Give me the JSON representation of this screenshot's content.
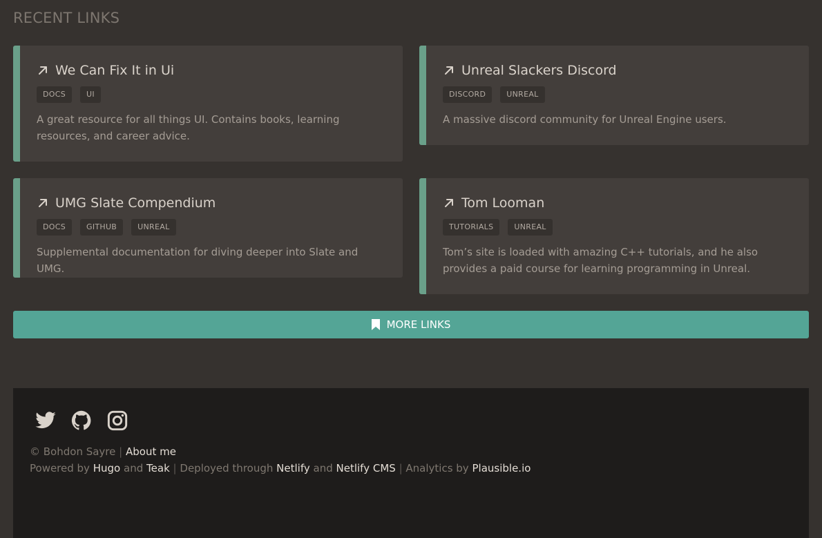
{
  "section": {
    "title": "RECENT LINKS"
  },
  "cards": [
    {
      "title": "We Can Fix It in Ui",
      "tags": [
        "DOCS",
        "UI"
      ],
      "description": "A great resource for all things UI. Contains books, learning resources, and career advice."
    },
    {
      "title": "Unreal Slackers Discord",
      "tags": [
        "DISCORD",
        "UNREAL"
      ],
      "description": "A massive discord community for Unreal Engine users."
    },
    {
      "title": "UMG Slate Compendium",
      "tags": [
        "DOCS",
        "GITHUB",
        "UNREAL"
      ],
      "description": "Supplemental documentation for diving deeper into Slate and UMG."
    },
    {
      "title": "Tom Looman",
      "tags": [
        "TUTORIALS",
        "UNREAL"
      ],
      "description": "Tom’s site is loaded with amazing C++ tutorials, and he also provides a paid course for learning programming in Unreal."
    }
  ],
  "more_button": {
    "label": "MORE LINKS",
    "icon": "bookmark-icon"
  },
  "footer": {
    "social": [
      {
        "icon": "twitter-icon"
      },
      {
        "icon": "github-icon"
      },
      {
        "icon": "instagram-icon"
      }
    ],
    "copyright": "© Bohdon Sayre",
    "sep": "|",
    "about": "About me",
    "powered_by": "Powered by",
    "hugo": "Hugo",
    "and": "and",
    "teak": "Teak",
    "deployed": "Deployed through",
    "netlify": "Netlify",
    "netlify_cms": "Netlify CMS",
    "analytics": "Analytics by",
    "plausible": "Plausible.io"
  },
  "colors": {
    "background": "#36322f",
    "card": "#433e3b",
    "card_accent": "#6aa08a",
    "button": "#54a596",
    "footer": "#1e1c1b"
  }
}
